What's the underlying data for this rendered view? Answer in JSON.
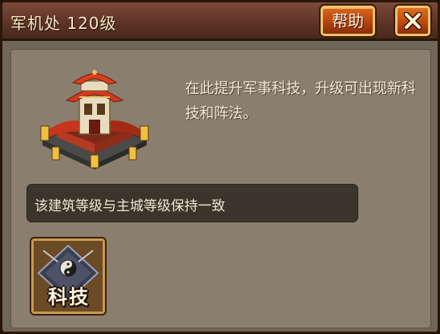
{
  "window": {
    "title": "军机处 120级",
    "help_label": "帮助"
  },
  "building": {
    "description": "在此提升军事科技，升级可出现新科技和阵法。",
    "notice": "该建筑等级与主城等级保持一致"
  },
  "tech_button": {
    "label": "科技"
  },
  "icons": {
    "close": "close-x-icon",
    "building": "pagoda-building-icon",
    "tech": "yin-yang-tech-icon"
  },
  "colors": {
    "panel": "#8a7f6e",
    "title_bar": "#5e3426",
    "button_orange": "#d8661e",
    "gold_border": "#e9c36a"
  }
}
